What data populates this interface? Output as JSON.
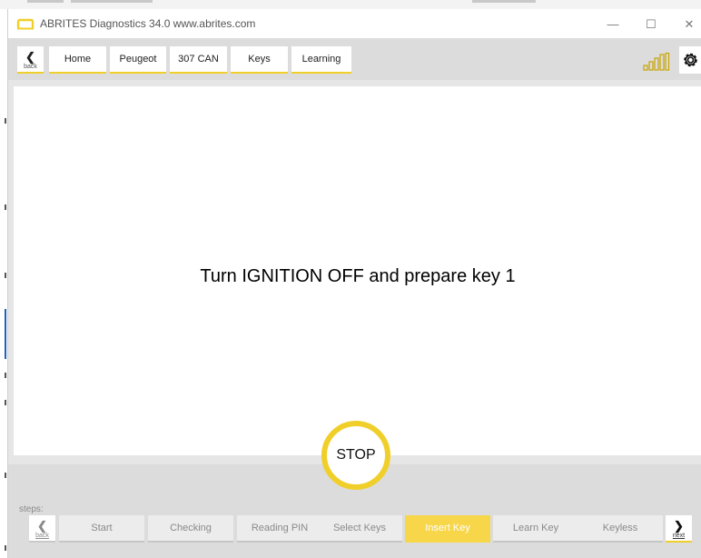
{
  "window": {
    "title": "ABRITES Diagnostics 34.0   www.abrites.com",
    "controls": [
      "—",
      "☐",
      "✕"
    ]
  },
  "nav": {
    "back_label": "back",
    "breadcrumbs": [
      "Home",
      "Peugeot",
      "307 CAN",
      "Keys",
      "Learning"
    ]
  },
  "main": {
    "message": "Turn IGNITION OFF and prepare key 1",
    "stop_label": "STOP"
  },
  "steps": {
    "label": "steps:",
    "back_label": "back",
    "next_label": "next",
    "items": [
      "Start",
      "Checking",
      "Reading PIN",
      "Select Keys",
      "Insert Key",
      "Learn Key",
      "Keyless"
    ],
    "active": "Insert Key"
  },
  "icons": {
    "back": "chevron-left-icon",
    "next": "chevron-right-icon",
    "signal": "signal-strength-icon",
    "settings": "gear-icon",
    "logo": "abrites-logo-icon"
  },
  "colors": {
    "accent": "#f0cf2a",
    "active_step": "#f7d64a",
    "toolbar": "#dcdcdc",
    "signal": "#c9a400"
  }
}
